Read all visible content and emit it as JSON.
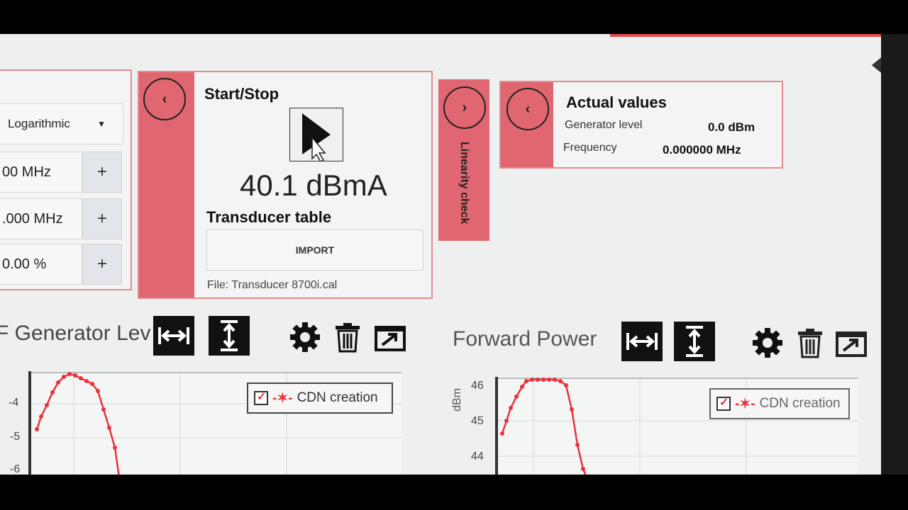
{
  "left_panel": {
    "scale_select": "Logarithmic",
    "field1": "00 MHz",
    "field2": ".000 MHz",
    "field3": "0.00 %",
    "plus": "+"
  },
  "start_panel": {
    "title": "Start/Stop",
    "reading": "40.1 dBmA",
    "transducer_title": "Transducer table",
    "import_label": "IMPORT",
    "file_label": "File: Transducer 8700i.cal"
  },
  "linearity": {
    "label": "Linearity check"
  },
  "actual": {
    "title": "Actual values",
    "gen_label": "Generator level",
    "gen_value": "0.0 dBm",
    "freq_label": "Frequency",
    "freq_value": "0.000000 MHz"
  },
  "chart1": {
    "title": "F Generator Lev",
    "legend": "CDN creation",
    "ticks": [
      "-4",
      "-5",
      "-6"
    ]
  },
  "chart2": {
    "title": "Forward Power",
    "legend": "CDN creation",
    "ylabel": "dBm",
    "ticks": [
      "46",
      "45",
      "44"
    ]
  },
  "colors": {
    "accent": "#e06771",
    "border": "#e38c92",
    "series": "#e8323c"
  },
  "icons": [
    "chevron-left-icon",
    "chevron-right-icon",
    "play-icon",
    "fit-horizontal-icon",
    "fit-vertical-icon",
    "gear-icon",
    "trash-icon",
    "export-icon"
  ]
}
